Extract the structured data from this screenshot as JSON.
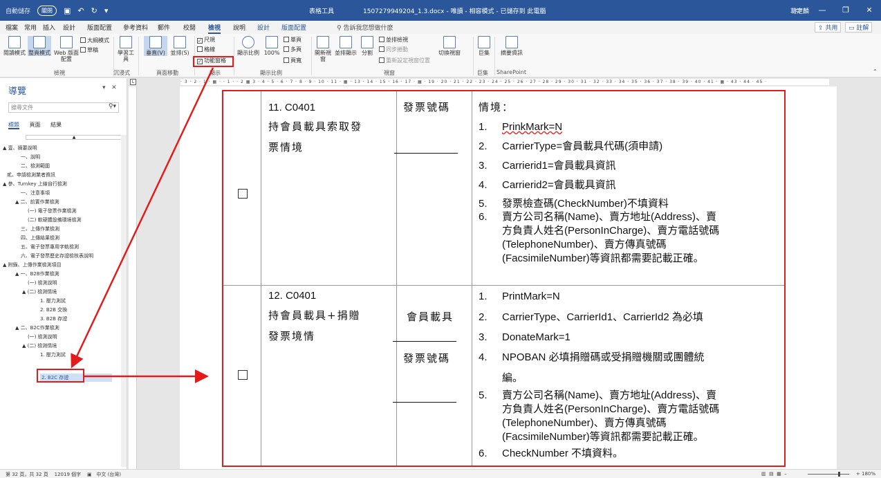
{
  "titlebar": {
    "autosave": "自動儲存",
    "autosave_toggle": "關閉",
    "context_tab": "表格工具",
    "document_title": "1507279949204_1.3.docx - 唯讀 - 相容模式 - 已儲存到 此電腦",
    "user": "葛定麟"
  },
  "tabs": [
    {
      "label": "檔案"
    },
    {
      "label": "常用"
    },
    {
      "label": "插入"
    },
    {
      "label": "設計"
    },
    {
      "label": "版面配置"
    },
    {
      "label": "參考資料"
    },
    {
      "label": "郵件"
    },
    {
      "label": "校閱"
    },
    {
      "label": "檢視"
    },
    {
      "label": "說明"
    },
    {
      "label": "設計"
    },
    {
      "label": "版面配置"
    }
  ],
  "tell_me": "告訴我您想做什麼",
  "share_label": "共用",
  "comment_label": "註解",
  "ribbon": {
    "read_mode": "閱讀模式",
    "print_layout": "整頁模式",
    "web_layout": "Web 版面配置",
    "outline": "大綱模式",
    "draft": "草稿",
    "learning_tools": "學習工具",
    "vertical": "垂直(V)",
    "side_to_side": "並排(S)",
    "ruler": "尺規",
    "gridlines": "格線",
    "nav_pane": "功能窗格",
    "zoom": "顯示比例",
    "zoom_100": "100%",
    "one_page": "單頁",
    "multi_page": "多頁",
    "page_width": "頁寬",
    "new_window": "開新視窗",
    "arrange_all": "並排顯示",
    "split": "分割",
    "side_by_side": "並排檢視",
    "sync_scroll": "同步捲動",
    "reset_window": "重新設定視窗位置",
    "switch_windows": "切換視窗",
    "macros": "巨集",
    "summary": "摘要資訊",
    "groups": {
      "views": "檢視",
      "immersive": "沉浸式",
      "page_movement": "頁面移動",
      "show": "顯示",
      "zoom": "顯示比例",
      "window": "視窗",
      "macros": "巨集",
      "sharepoint": "SharePoint"
    }
  },
  "nav": {
    "title": "導覽",
    "search_placeholder": "搜尋文件",
    "tabs": [
      "標題",
      "頁面",
      "結果"
    ],
    "items": [
      {
        "label": "▲ 壹、摘要說明"
      },
      {
        "label": "一、說明"
      },
      {
        "label": "二、檢測範圍"
      },
      {
        "label": "貳、申請檢測業者資訊"
      },
      {
        "label": "▲ 參、Turnkey 上線自行檢測"
      },
      {
        "label": "一、注意事項"
      },
      {
        "label": "▲ 二、前置作業檢測"
      },
      {
        "label": "(一) 電子發票作業檢測"
      },
      {
        "label": "(二) 軟硬體設備環境檢測"
      },
      {
        "label": "三、上傳作業檢測"
      },
      {
        "label": "四、上傳結果檢測"
      },
      {
        "label": "五、電子發票專用字軌檢測"
      },
      {
        "label": "六、電子發票歷史存證檢核表說明"
      },
      {
        "label": "▲ 附錄、上傳作業檢測項目"
      },
      {
        "label": "▲ 一、B2B作業檢測"
      },
      {
        "label": "(一) 檢測說明"
      },
      {
        "label": "▲ (二) 檢測情境"
      },
      {
        "label": "1. 壓力測試"
      },
      {
        "label": "2. B2B 交換"
      },
      {
        "label": "3. B2B 存證"
      },
      {
        "label": "▲ 二、B2C作業檢測"
      },
      {
        "label": "(一) 檢測說明"
      },
      {
        "label": "▲ (二) 檢測情境"
      },
      {
        "label": "1. 壓力測試"
      },
      {
        "label": "2. B2C 存證"
      }
    ]
  },
  "doc": {
    "row1": {
      "case_no": "11. C0401",
      "case_title_1": "持會員載具索取發",
      "case_title_2": "票情境",
      "field": "發票號碼",
      "scenario_label": "情境：",
      "items": [
        {
          "n": "1.",
          "text": "PrinkMark=N"
        },
        {
          "n": "2.",
          "text": "CarrierType=會員載具代碼(須申請)"
        },
        {
          "n": "3.",
          "text": "Carrierid1=會員載具資訊"
        },
        {
          "n": "4.",
          "text": "Carrierid2=會員載具資訊"
        },
        {
          "n": "5.",
          "text": "發票檢查碼(CheckNumber)不填資料"
        },
        {
          "n": "6.",
          "text": "賣方公司名稱(Name)、賣方地址(Address)、賣"
        }
      ],
      "item6_l2": "方負責人姓名(PersonInCharge)、賣方電話號碼",
      "item6_l3": "(TelephoneNumber)、賣方傳真號碼",
      "item6_l4": "(FacsimileNumber)等資訊都需要記載正確。"
    },
    "row2": {
      "case_no": "12. C0401",
      "case_title_1": "持會員載具+捐贈",
      "case_title_2": "發票境情",
      "field_1": "會員載具",
      "field_2": "發票號碼",
      "items": [
        {
          "n": "1.",
          "text": "PrintMark=N"
        },
        {
          "n": "2.",
          "text": "CarrierType、CarrierId1、CarrierId2 為必填"
        },
        {
          "n": "3.",
          "text": "DonateMark=1"
        },
        {
          "n": "4.",
          "text": "NPOBAN 必填捐贈碼或受捐贈機關或團體統"
        },
        {
          "n": "5.",
          "text": "賣方公司名稱(Name)、賣方地址(Address)、賣"
        },
        {
          "n": "6.",
          "text": "CheckNumber 不填資料。"
        }
      ],
      "item4_l2": "編。",
      "item5_l2": "方負責人姓名(PersonInCharge)、賣方電話號碼",
      "item5_l3": "(TelephoneNumber)、賣方傳真號碼",
      "item5_l4": "(FacsimileNumber)等資訊都需要記載正確。"
    }
  },
  "status": {
    "page": "第 32 頁，共 32 頁",
    "words": "12019 個字",
    "lang": "中文 (台灣)",
    "zoom": "180%"
  },
  "colors": {
    "accent": "#2b579a",
    "highlight": "#e31b1b"
  }
}
